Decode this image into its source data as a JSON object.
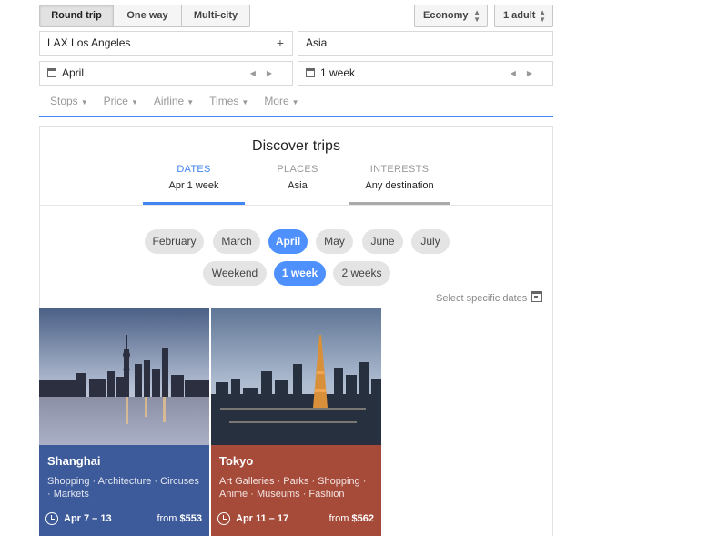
{
  "trip_types": [
    "Round trip",
    "One way",
    "Multi-city"
  ],
  "cabin": "Economy",
  "passengers": "1 adult",
  "origin": "LAX Los Angeles",
  "destination": "Asia",
  "departure": "April",
  "duration": "1 week",
  "filters": [
    "Stops",
    "Price",
    "Airline",
    "Times",
    "More"
  ],
  "discover": {
    "title": "Discover trips",
    "tabs": [
      {
        "label": "DATES",
        "value": "Apr 1 week"
      },
      {
        "label": "PLACES",
        "value": "Asia"
      },
      {
        "label": "INTERESTS",
        "value": "Any destination"
      }
    ],
    "months": [
      "February",
      "March",
      "April",
      "May",
      "June",
      "July"
    ],
    "selected_month": "April",
    "durations": [
      "Weekend",
      "1 week",
      "2 weeks"
    ],
    "selected_duration": "1 week",
    "specific_dates_label": "Select specific dates"
  },
  "cards": [
    {
      "city": "Shanghai",
      "tags": "Shopping · Architecture · Circuses · Markets",
      "dates": "Apr 7 – 13",
      "price_prefix": "from",
      "price": "$553",
      "color": "#3d5a9a"
    },
    {
      "city": "Tokyo",
      "tags": "Art Galleries · Parks · Shopping · Anime · Museums · Fashion",
      "dates": "Apr 11 – 17",
      "price_prefix": "from",
      "price": "$562",
      "color": "#a64b3a"
    }
  ],
  "colors": {
    "accent": "#4285f4",
    "chip_selected": "#4d90fe"
  }
}
